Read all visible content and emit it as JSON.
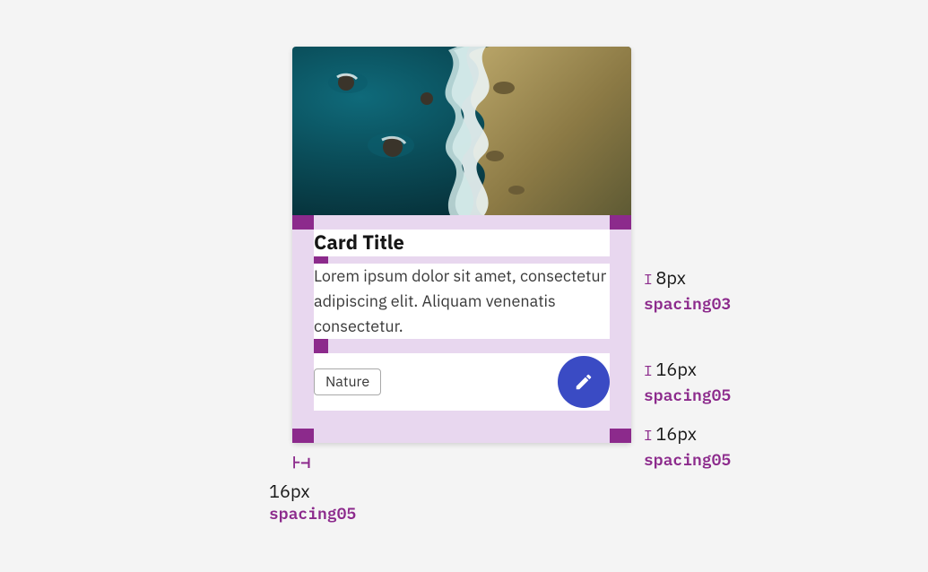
{
  "card": {
    "title": "Card Title",
    "body": "Lorem ipsum dolor sit amet, consectetur adipiscing elit. Aliquam venenatis consectetur.",
    "tag": "Nature"
  },
  "annotations": {
    "gap_title_body": {
      "px": "8px",
      "token": "spacing03"
    },
    "gap_body_footer": {
      "px": "16px",
      "token": "spacing05"
    },
    "padding_bottom": {
      "px": "16px",
      "token": "spacing05"
    },
    "padding_left": {
      "px": "16px",
      "token": "spacing05"
    }
  },
  "colors": {
    "highlight_light": "#e8d7ef",
    "highlight_dark": "#8c2a8c",
    "fab": "#3a4bc4"
  }
}
